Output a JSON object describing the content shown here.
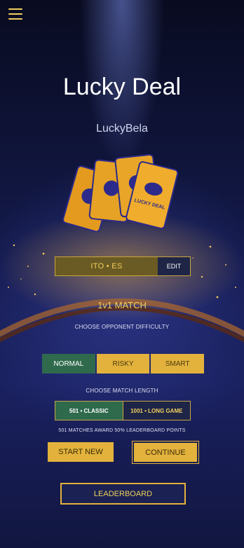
{
  "app": {
    "title": "Lucky Deal",
    "player_name": "LuckyBela"
  },
  "card_text": "LUCKY DEAL",
  "language": {
    "label": "ITO • ES",
    "edit_label": "EDIT"
  },
  "mode": {
    "title": "1v1 MATCH"
  },
  "difficulty": {
    "caption": "CHOOSE OPPONENT DIFFICULTY",
    "options": [
      "NORMAL",
      "RISKY",
      "SMART"
    ],
    "selected": "NORMAL"
  },
  "match_length": {
    "caption": "CHOOSE MATCH LENGTH",
    "options": [
      "501 • CLASSIC",
      "1001 • LONG GAME"
    ],
    "selected": "501 • CLASSIC",
    "note": "501 MATCHES AWARD 50% LEADERBOARD POINTS"
  },
  "actions": {
    "start_new": "START NEW",
    "continue": "CONTINUE",
    "leaderboard": "LEADERBOARD"
  },
  "colors": {
    "accent_gold": "#e3b23c",
    "selected_green": "#2f6a4d",
    "background_navy": "#121845",
    "highlight_text": "#f2cf5c"
  },
  "icons": {
    "menu": "hamburger-menu-icon"
  }
}
